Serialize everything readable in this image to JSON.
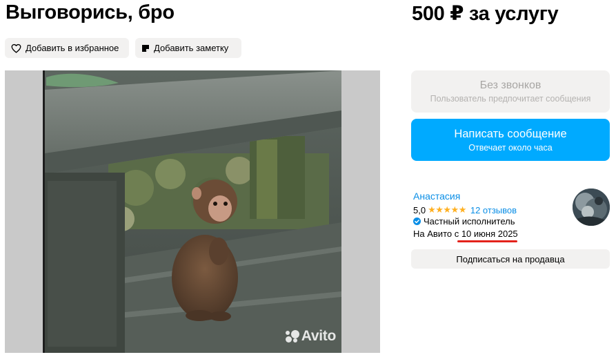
{
  "listing": {
    "title": "Выговорись, бро",
    "price": "500 ₽ за услугу"
  },
  "actions": {
    "favorite_label": "Добавить в избранное",
    "note_label": "Добавить заметку"
  },
  "gallery": {
    "watermark": "Avito"
  },
  "contact": {
    "calls_title": "Без звонков",
    "calls_subtitle": "Пользователь предпочитает сообщения",
    "message_title": "Написать сообщение",
    "message_subtitle": "Отвечает около часа",
    "accent_color": "#00aaff"
  },
  "seller": {
    "name": "Анастасия",
    "rating": "5,0",
    "stars": "★★★★★",
    "stars_count": 5,
    "reviews": "12 отзывов",
    "type": "Частный исполнитель",
    "since": "На Авито с 10 июня 2025",
    "subscribe_label": "Подписаться на продавца",
    "highlight_color": "#e3221b"
  },
  "icons": {
    "favorite": "heart-icon",
    "note": "note-icon",
    "verified": "verified-check-icon"
  }
}
